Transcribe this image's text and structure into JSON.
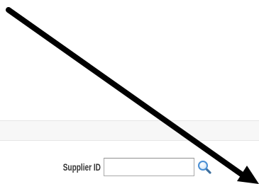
{
  "search": {
    "label": "Supplier ID",
    "input_value": "",
    "lookup_icon": "magnifier-icon"
  },
  "annotation": {
    "icon": "arrow-icon",
    "color": "#000000"
  },
  "colors": {
    "band": "#f7f7f7",
    "label": "#333333",
    "lookup_icon": "#4a8fd4"
  }
}
